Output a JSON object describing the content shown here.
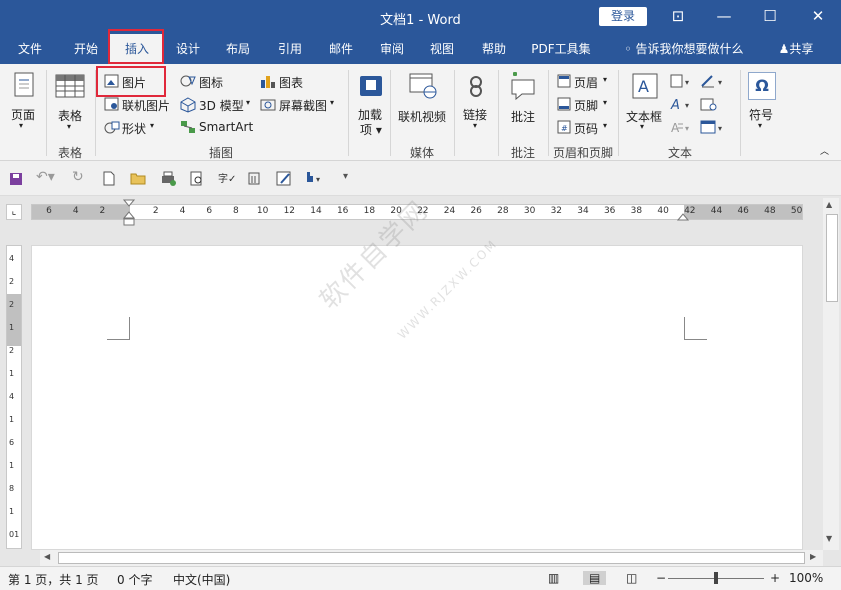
{
  "titlebar": {
    "title": "文档1  -  Word",
    "login": "登录",
    "btns": [
      "⊡",
      "—",
      "☐",
      "✕"
    ]
  },
  "tabs": [
    "文件",
    "开始",
    "插入",
    "设计",
    "布局",
    "引用",
    "邮件",
    "审阅",
    "视图",
    "帮助",
    "PDF工具集"
  ],
  "tellme": "告诉我你想要做什么",
  "share": "共享",
  "ribbon": {
    "page": "页面",
    "table": "表格",
    "table_group": "表格",
    "picture": "图片",
    "online_picture": "联机图片",
    "shapes": "形状",
    "icons": "图标",
    "model3d": "3D 模型",
    "smartart": "SmartArt",
    "chart": "图表",
    "screenshot": "屏幕截图",
    "illus_group": "插图",
    "addins": "加载\n项",
    "online_video": "联机视频",
    "media_group": "媒体",
    "link": "链接",
    "comment": "批注",
    "comment_group": "批注",
    "header": "页眉",
    "footer": "页脚",
    "pagenum": "页码",
    "hf_group": "页眉和页脚",
    "textbox": "文本框",
    "text_group": "文本",
    "symbol": "符号"
  },
  "ruler": {
    "ticks": [
      "6",
      "4",
      "2",
      "",
      "2",
      "4",
      "6",
      "8",
      "10",
      "12",
      "14",
      "16",
      "18",
      "20",
      "22",
      "24",
      "26",
      "28",
      "30",
      "32",
      "34",
      "36",
      "38",
      "40",
      "42",
      "44",
      "46",
      "48",
      "50"
    ],
    "vticks": [
      "4",
      "2",
      "2",
      "1",
      "2",
      "1",
      "4",
      "1",
      "6",
      "1",
      "8",
      "1",
      "01"
    ]
  },
  "watermark": {
    "main": "软件自学网",
    "sub": "WWW.RJZXW.COM"
  },
  "status": {
    "page": "第 1 页，共 1 页",
    "words": "0 个字",
    "lang": "中文(中国)",
    "zoom": "100%"
  },
  "colors": {
    "brand": "#2b579a",
    "highlight": "#e0283a"
  }
}
